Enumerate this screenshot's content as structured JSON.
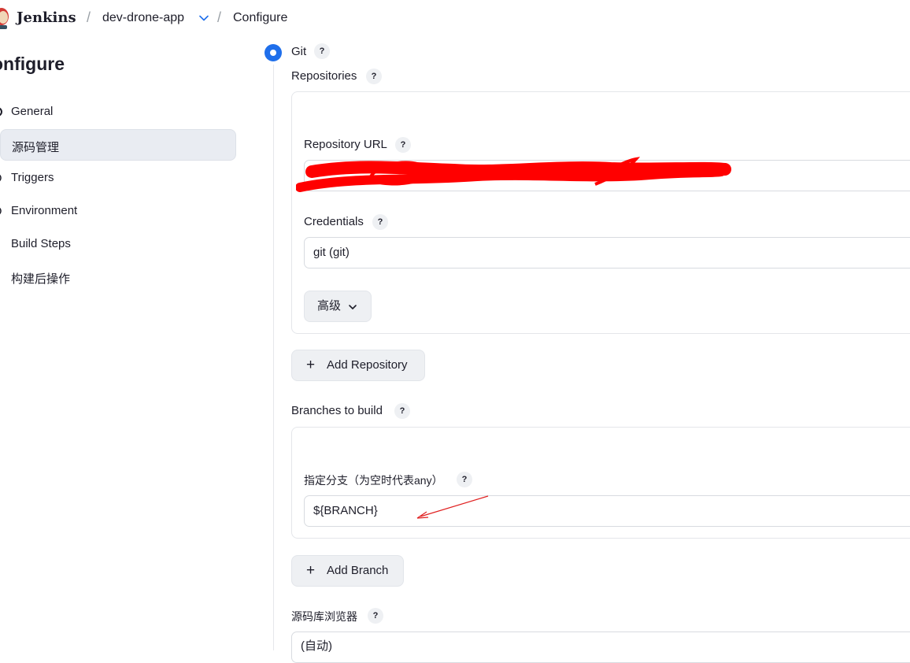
{
  "header": {
    "brand": "Jenkins",
    "breadcrumbs": [
      "dev-drone-app",
      "Configure"
    ],
    "separator": "/"
  },
  "page_title": "onfigure",
  "sidebar": {
    "items": [
      {
        "label": "General",
        "icon": "gear-icon",
        "active": false
      },
      {
        "label": "源码管理",
        "icon": "code-branch-icon",
        "active": true
      },
      {
        "label": "Triggers",
        "icon": "clock-icon",
        "active": false
      },
      {
        "label": "Environment",
        "icon": "globe-icon",
        "active": false
      },
      {
        "label": "Build Steps",
        "icon": "list-icon",
        "active": false
      },
      {
        "label": "构建后操作",
        "icon": "box-icon",
        "active": false
      }
    ]
  },
  "scm": {
    "git_label": "Git",
    "help": "?",
    "repositories_label": "Repositories",
    "repository_url_label": "Repository URL",
    "repository_url_value": "",
    "credentials_label": "Credentials",
    "credentials_value": "git (git)",
    "advanced_label": "高级",
    "add_repository_label": "Add Repository",
    "branches_label": "Branches to build",
    "branch_specifier_label": "指定分支（为空时代表any）",
    "branch_specifier_value": "${BRANCH}",
    "add_branch_label": "Add Branch",
    "repo_browser_label": "源码库浏览器",
    "repo_browser_value": "(自动)"
  },
  "colors": {
    "accent": "#1f6feb",
    "redaction": "#ff0000",
    "annotation_arrow": "#e02020",
    "active_nav": "#e9ecf2"
  }
}
